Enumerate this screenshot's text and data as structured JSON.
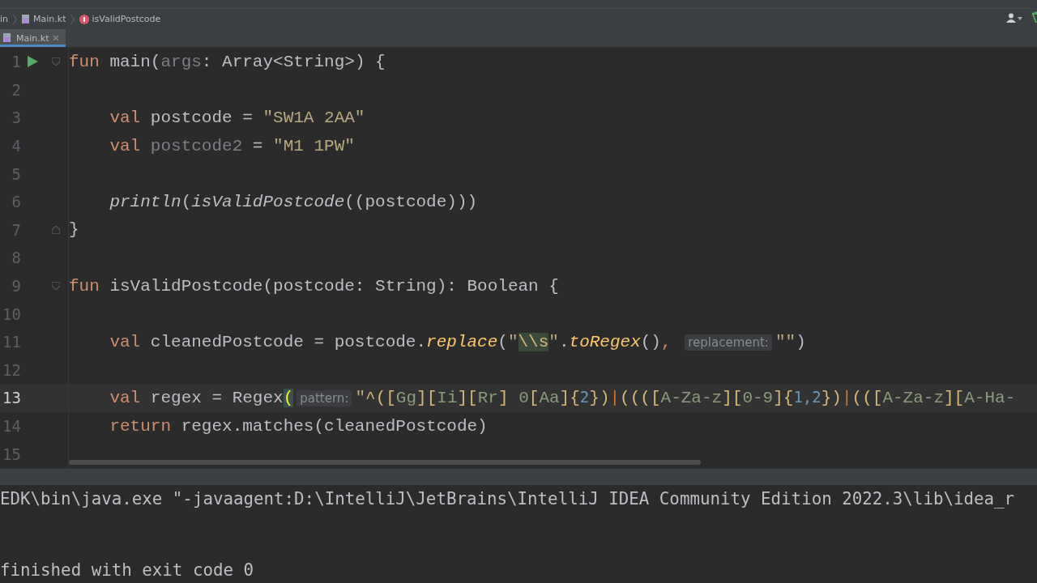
{
  "breadcrumbs": [
    {
      "label": "in",
      "kind": "plain"
    },
    {
      "label": "Main.kt",
      "kind": "file"
    },
    {
      "label": "isValidPostcode",
      "kind": "function"
    }
  ],
  "tabs": [
    {
      "label": "Main.kt",
      "selected": true
    }
  ],
  "editor": {
    "lines": [
      {
        "number": "1",
        "current": false,
        "run": true,
        "fold_start": true,
        "tokens": [
          {
            "kind": "kw",
            "text": "fun"
          },
          {
            "kind": "id",
            "text": " main("
          },
          {
            "kind": "unused",
            "text": "args"
          },
          {
            "kind": "id",
            "text": ": Array<String>) {"
          }
        ]
      },
      {
        "number": "2",
        "current": false
      },
      {
        "number": "3",
        "current": false,
        "tokens": [
          {
            "kind": "kw",
            "text": "    val"
          },
          {
            "kind": "id",
            "text": " postcode = "
          },
          {
            "kind": "str",
            "text": "\"SW1A 2AA\""
          }
        ]
      },
      {
        "number": "4",
        "current": false,
        "tokens": [
          {
            "kind": "kw",
            "text": "    val"
          },
          {
            "kind": "unused",
            "text": " postcode2"
          },
          {
            "kind": "id",
            "text": " = "
          },
          {
            "kind": "str",
            "text": "\"M1 1PW\""
          }
        ]
      },
      {
        "number": "5",
        "current": false
      },
      {
        "number": "6",
        "current": false,
        "tokens": [
          {
            "kind": "call",
            "text": "    println"
          },
          {
            "kind": "id",
            "text": "("
          },
          {
            "kind": "call",
            "text": "isValidPostcode"
          },
          {
            "kind": "id",
            "text": "((postcode)))"
          }
        ]
      },
      {
        "number": "7",
        "current": false,
        "fold_end": true,
        "tokens": [
          {
            "kind": "id",
            "text": "}"
          }
        ]
      },
      {
        "number": "8",
        "current": false
      },
      {
        "number": "9",
        "current": false,
        "fold_start": true,
        "tokens": [
          {
            "kind": "kw",
            "text": "fun"
          },
          {
            "kind": "id",
            "text": " isValidPostcode(postcode: String): Boolean {"
          }
        ]
      },
      {
        "number": "10",
        "current": false
      },
      {
        "number": "11",
        "current": false,
        "tokens": [
          {
            "kind": "kw",
            "text": "    val"
          },
          {
            "kind": "id",
            "text": " cleanedPostcode = postcode."
          },
          {
            "kind": "fn",
            "text": "replace"
          },
          {
            "kind": "id",
            "text": "("
          },
          {
            "kind": "str",
            "text": "\""
          },
          {
            "kind": "esc",
            "text": "\\\\s"
          },
          {
            "kind": "str",
            "text": "\""
          },
          {
            "kind": "id",
            "text": "."
          },
          {
            "kind": "fn",
            "text": "toRegex"
          },
          {
            "kind": "id",
            "text": "()"
          },
          {
            "kind": "kw",
            "text": ", "
          },
          {
            "kind": "hint",
            "text": "replacement:"
          },
          {
            "kind": "str",
            "text": "\"\""
          },
          {
            "kind": "id",
            "text": ")"
          }
        ]
      },
      {
        "number": "12",
        "current": false
      },
      {
        "number": "13",
        "current": true,
        "tokens": [
          {
            "kind": "kw",
            "text": "    val"
          },
          {
            "kind": "id",
            "text": " regex = Regex"
          },
          {
            "kind": "match",
            "text": "("
          },
          {
            "kind": "hint",
            "text": "pattern:"
          },
          {
            "kind": "str",
            "text": "\""
          },
          {
            "kind": "rxb",
            "text": "^(["
          },
          {
            "kind": "rxc",
            "text": "Gg"
          },
          {
            "kind": "rxb",
            "text": "]["
          },
          {
            "kind": "rxc",
            "text": "Ii"
          },
          {
            "kind": "rxb",
            "text": "]["
          },
          {
            "kind": "rxc",
            "text": "Rr"
          },
          {
            "kind": "rxb",
            "text": "]"
          },
          {
            "kind": "rxc",
            "text": " 0"
          },
          {
            "kind": "rxb",
            "text": "["
          },
          {
            "kind": "rxc",
            "text": "Aa"
          },
          {
            "kind": "rxb",
            "text": "]{"
          },
          {
            "kind": "num",
            "text": "2"
          },
          {
            "kind": "rxb",
            "text": "})"
          },
          {
            "kind": "bar",
            "text": "|"
          },
          {
            "kind": "rxb",
            "text": "(((["
          },
          {
            "kind": "rxc",
            "text": "A-Za-z"
          },
          {
            "kind": "rxb",
            "text": "]["
          },
          {
            "kind": "rxc",
            "text": "0-9"
          },
          {
            "kind": "rxb",
            "text": "]{"
          },
          {
            "kind": "num",
            "text": "1,2"
          },
          {
            "kind": "rxb",
            "text": "})"
          },
          {
            "kind": "bar",
            "text": "|"
          },
          {
            "kind": "rxb",
            "text": "((["
          },
          {
            "kind": "rxc",
            "text": "A-Za-z"
          },
          {
            "kind": "rxb",
            "text": "]["
          },
          {
            "kind": "rxc",
            "text": "A-Ha-"
          }
        ]
      },
      {
        "number": "14",
        "current": false,
        "tokens": [
          {
            "kind": "kw",
            "text": "    return"
          },
          {
            "kind": "id",
            "text": " regex.matches(cleanedPostcode)"
          }
        ]
      },
      {
        "number": "15",
        "current": false
      }
    ]
  },
  "console": {
    "command": "EDK\\bin\\java.exe \"-javaagent:D:\\IntelliJ\\JetBrains\\IntelliJ IDEA Community Edition 2022.3\\lib\\idea_r",
    "status": "finished with exit code 0"
  }
}
